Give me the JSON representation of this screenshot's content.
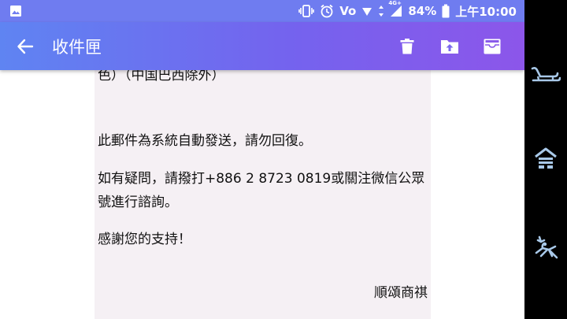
{
  "status_bar": {
    "battery_percent": "84%",
    "time": "上午10:00",
    "volte_label": "Vo",
    "network_label": "4G+"
  },
  "app_bar": {
    "title": "收件匣"
  },
  "email": {
    "partial_line": "色）（中国巴西除外）",
    "notice": "此郵件為系統自動發送，請勿回復。",
    "contact_line1": "如有疑問，請撥打+886 2 8723 0819或關注微信公眾",
    "contact_line2": "號進行諮詢。",
    "thanks": "感謝您的支持！",
    "signature": "順頌商祺"
  },
  "colors": {
    "accent_left": "#5f84f2",
    "accent_right": "#8c56ea",
    "dock_icon": "#a8c8e8"
  }
}
